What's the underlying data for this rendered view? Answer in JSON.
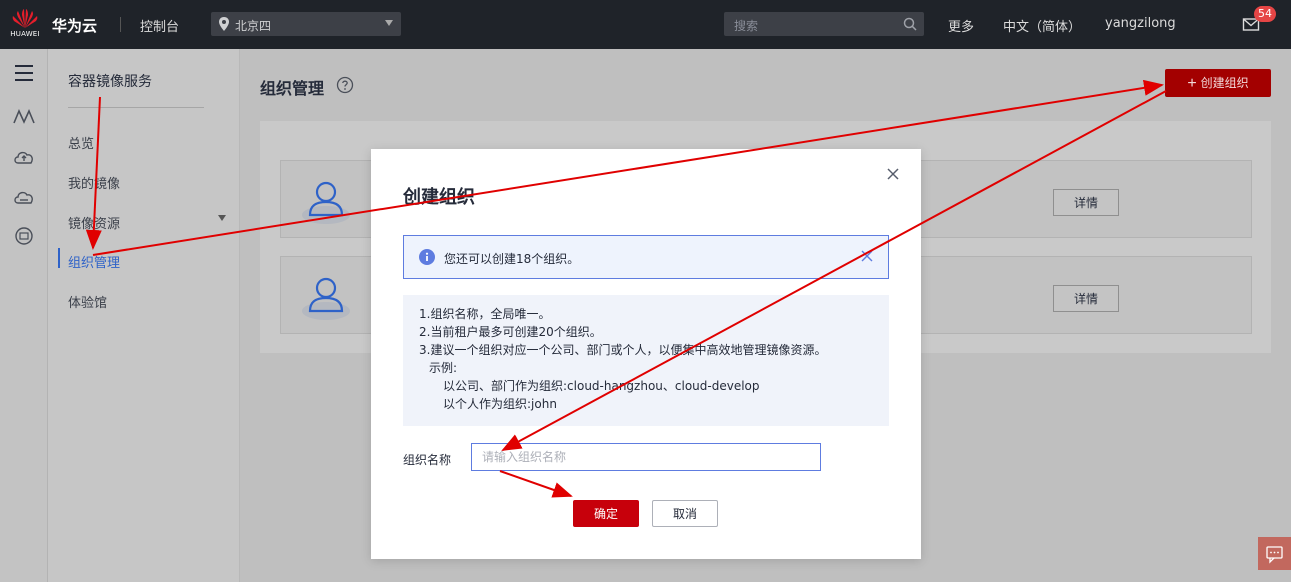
{
  "header": {
    "logo_text": "HUAWEI",
    "brand": "华为云",
    "console": "控制台",
    "region": "北京四",
    "search_placeholder": "搜索",
    "more": "更多",
    "language": "中文（简体）",
    "username": "yangzilong",
    "mail_count": "54"
  },
  "rail": {
    "icons": [
      "menu-icon",
      "service-m-icon",
      "cloud-upload-icon",
      "cloud-icon",
      "cloud-db-icon"
    ]
  },
  "subnav": {
    "title": "容器镜像服务",
    "items": [
      {
        "label": "总览"
      },
      {
        "label": "我的镜像"
      },
      {
        "label": "镜像资源"
      },
      {
        "label": "组织管理",
        "active": true
      },
      {
        "label": "体验馆"
      }
    ]
  },
  "main": {
    "title": "组织管理",
    "create_button": "创建组织",
    "cards": [
      {
        "detail_label": "详情"
      },
      {
        "detail_label": "详情"
      }
    ]
  },
  "modal": {
    "title": "创建组织",
    "info": "您还可以创建18个组织。",
    "notes": [
      "1.组织名称，全局唯一。",
      "2.当前租户最多可创建20个组织。",
      "3.建议一个组织对应一个公司、部门或个人，以便集中高效地管理镜像资源。",
      "示例:",
      "以公司、部门作为组织:cloud-hangzhou、cloud-develop",
      "以个人作为组织:john"
    ],
    "field_label": "组织名称",
    "field_placeholder": "请输入组织名称",
    "field_value": "",
    "ok_label": "确定",
    "cancel_label": "取消"
  },
  "colors": {
    "topbar": "#1f2329",
    "accent_red": "#c7000b",
    "link_blue": "#2e62c8",
    "annotation_arrow": "#e00000"
  }
}
